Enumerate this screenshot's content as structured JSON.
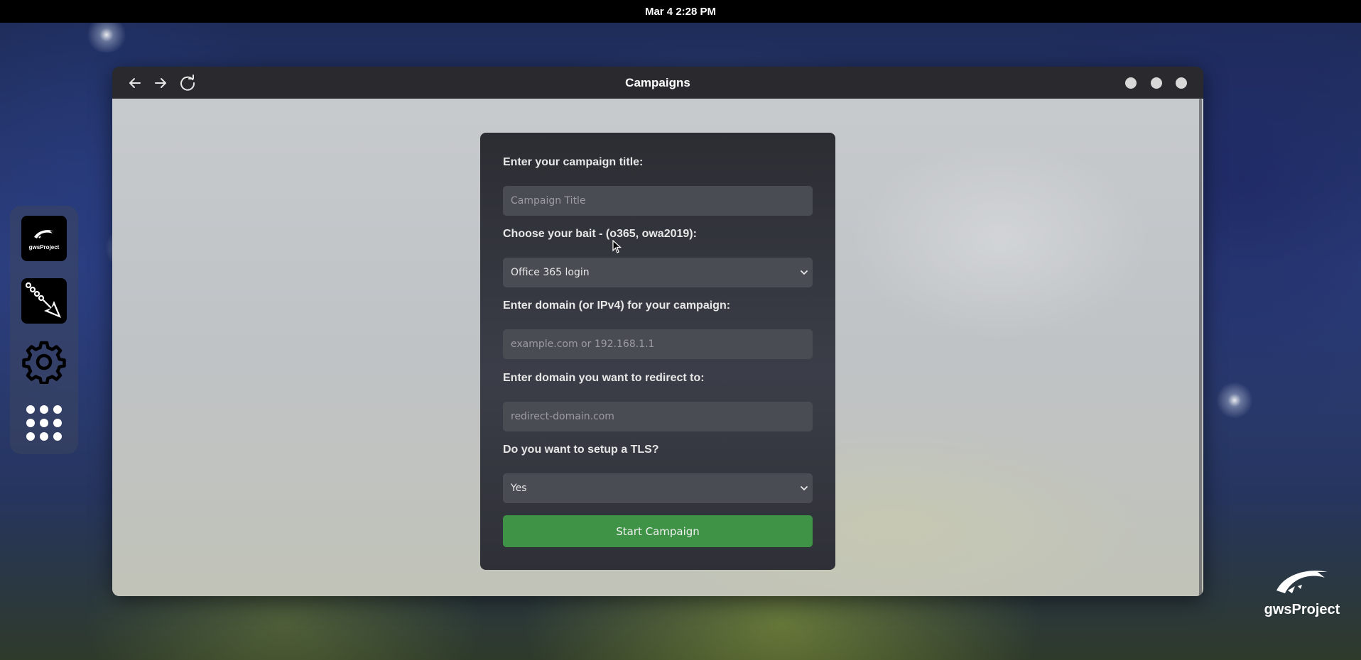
{
  "topbar": {
    "clock": "Mar 4  2:28 PM"
  },
  "dock": {
    "items": [
      {
        "name": "gwsProject",
        "label": "gwsProject",
        "icon": "gwsproject-logo-icon"
      },
      {
        "name": "phishing-arrow",
        "icon": "chain-arrow-icon"
      },
      {
        "name": "settings",
        "icon": "gear-icon"
      },
      {
        "name": "apps",
        "icon": "app-grid-icon"
      }
    ]
  },
  "window": {
    "title": "Campaigns",
    "nav": {
      "back": "arrow-left-icon",
      "forward": "arrow-right-icon",
      "reload": "reload-icon"
    }
  },
  "form": {
    "title_label": "Enter your campaign title:",
    "title_placeholder": "Campaign Title",
    "title_value": "",
    "bait_label": "Choose your bait - (o365, owa2019):",
    "bait_selected": "Office 365 login",
    "domain_label": "Enter domain (or IPv4) for your campaign:",
    "domain_placeholder": "example.com or 192.168.1.1",
    "domain_value": "",
    "redirect_label": "Enter domain you want to redirect to:",
    "redirect_placeholder": "redirect-domain.com",
    "redirect_value": "",
    "tls_label": "Do you want to setup a TLS?",
    "tls_selected": "Yes",
    "submit_label": "Start Campaign"
  },
  "brand": {
    "text": "gwsProject"
  },
  "colors": {
    "accent_green": "#3f9346",
    "card_bg": "#2c2d33",
    "field_bg": "#4a4c53",
    "titlebar_bg": "#2a2a2e"
  }
}
